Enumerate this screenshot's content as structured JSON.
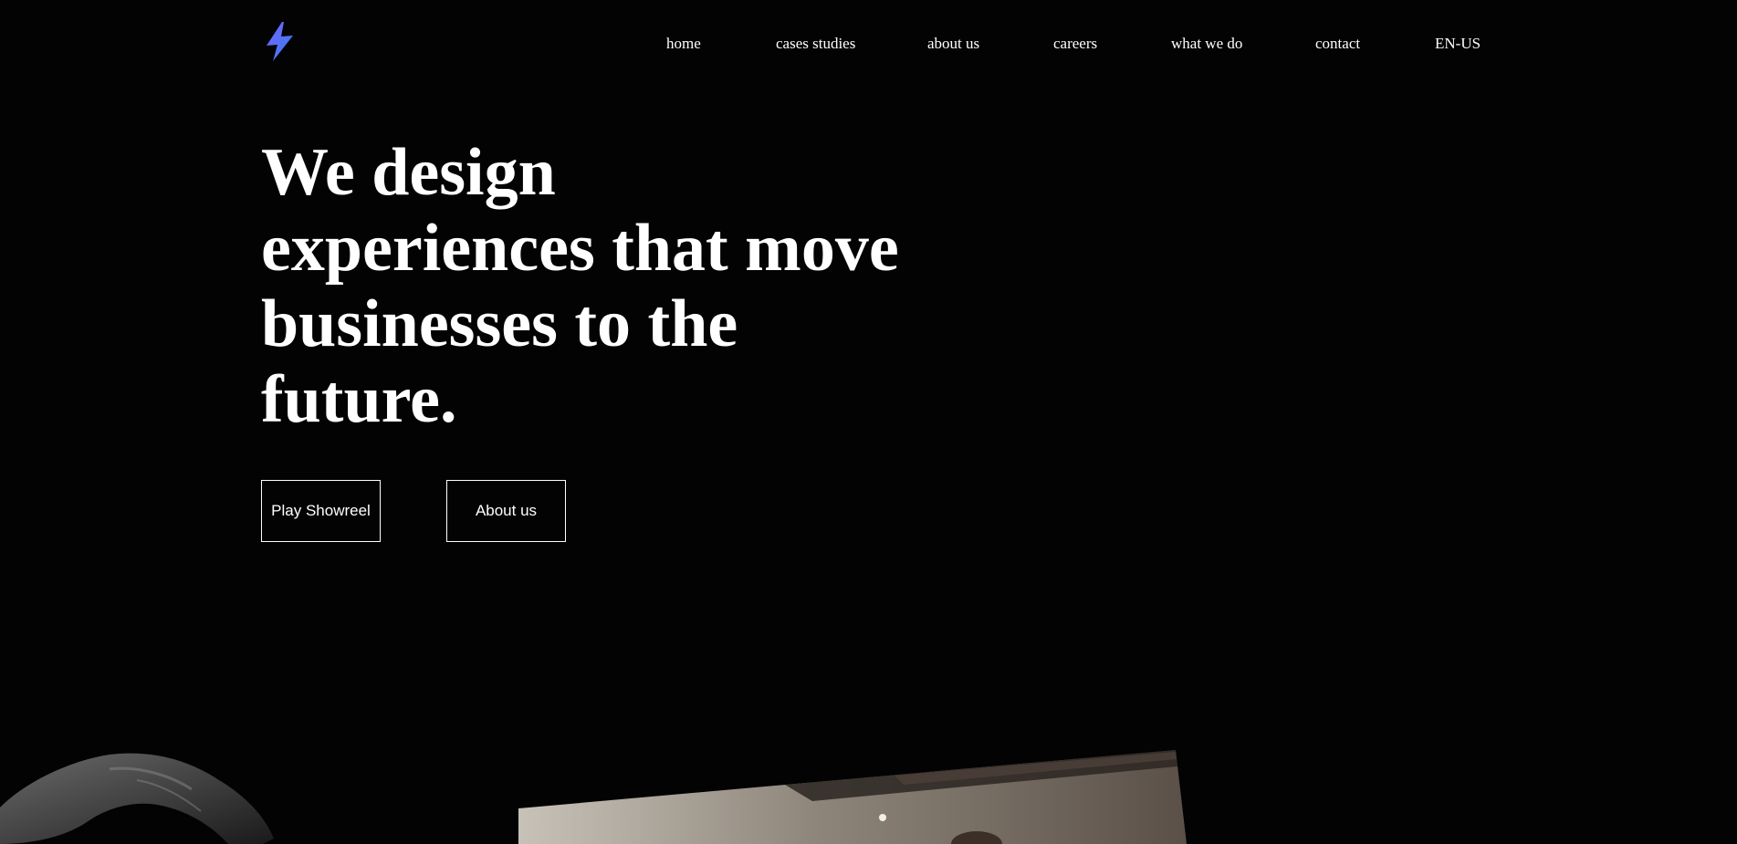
{
  "brand": {
    "logo_icon": "lightning-bolt-icon",
    "colors": [
      "#6b63ff",
      "#2f80ed"
    ]
  },
  "nav": {
    "items": [
      {
        "label": "home"
      },
      {
        "label": "cases studies"
      },
      {
        "label": "about us"
      },
      {
        "label": "careers"
      },
      {
        "label": "what we do"
      },
      {
        "label": "contact"
      },
      {
        "label": "EN-US"
      }
    ]
  },
  "hero": {
    "title": "We design experiences that move businesses to the future.",
    "buttons": {
      "showreel_label": "Play Showreel",
      "about_label": "About us"
    }
  },
  "colors": {
    "background": "#030303",
    "text": "#ffffff"
  }
}
